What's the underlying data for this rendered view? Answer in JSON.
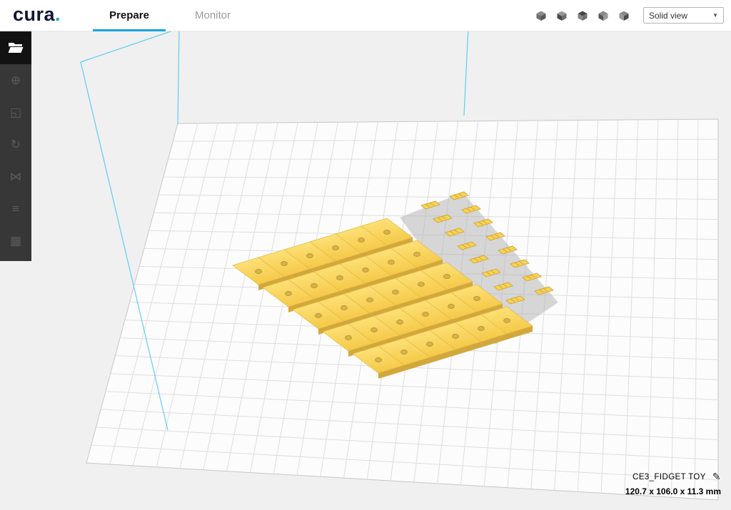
{
  "header": {
    "logo_text": "cura",
    "logo_dot": ".",
    "tabs": [
      {
        "label": "Prepare",
        "active": true
      },
      {
        "label": "Monitor",
        "active": false
      }
    ],
    "view_mode": {
      "value": "Solid view"
    },
    "view_buttons": [
      "view-3d",
      "view-front",
      "view-top",
      "view-left",
      "view-right"
    ]
  },
  "toolbar": {
    "items": [
      {
        "name": "open-file",
        "icon": "open-folder-icon",
        "glyph": "folder",
        "enabled": true
      },
      {
        "name": "move-tool",
        "icon": "move-icon",
        "glyph": "⊕",
        "enabled": false
      },
      {
        "name": "scale-tool",
        "icon": "scale-icon",
        "glyph": "◱",
        "enabled": false
      },
      {
        "name": "rotate-tool",
        "icon": "rotate-icon",
        "glyph": "↻",
        "enabled": false
      },
      {
        "name": "mirror-tool",
        "icon": "mirror-icon",
        "glyph": "⋈",
        "enabled": false
      },
      {
        "name": "per-model-settings",
        "icon": "per-model-settings-icon",
        "glyph": "≡",
        "enabled": false
      },
      {
        "name": "support-blocker",
        "icon": "support-blocker-icon",
        "glyph": "▦",
        "enabled": false
      }
    ]
  },
  "model_info": {
    "name": "CE3_FIDGET TOY",
    "dimensions": "120.7 x 106.0 x 11.3 mm"
  },
  "scene": {
    "wedge_rows": 5,
    "wedges_per_row": 6,
    "clip_rows": 8,
    "clips_per_row": 2,
    "colors": {
      "accent": "#14a6dc",
      "buildplate_fill": "#fcfcfc",
      "buildplate_line": "#dedede",
      "buildplate_edge": "#c6c6c6",
      "volume_line": "#46c8f1",
      "model_top_light": "#ffe57f",
      "model_top_dark": "#f5ca4b",
      "model_side": "#d2a83c",
      "model_stroke": "#e2b943",
      "hole_fill": "#d8b246",
      "hole_stroke": "#a9882e",
      "clip_fill": "#f8d252",
      "clip_stroke": "#c9a034",
      "shadow": "#b0b0b0"
    }
  }
}
